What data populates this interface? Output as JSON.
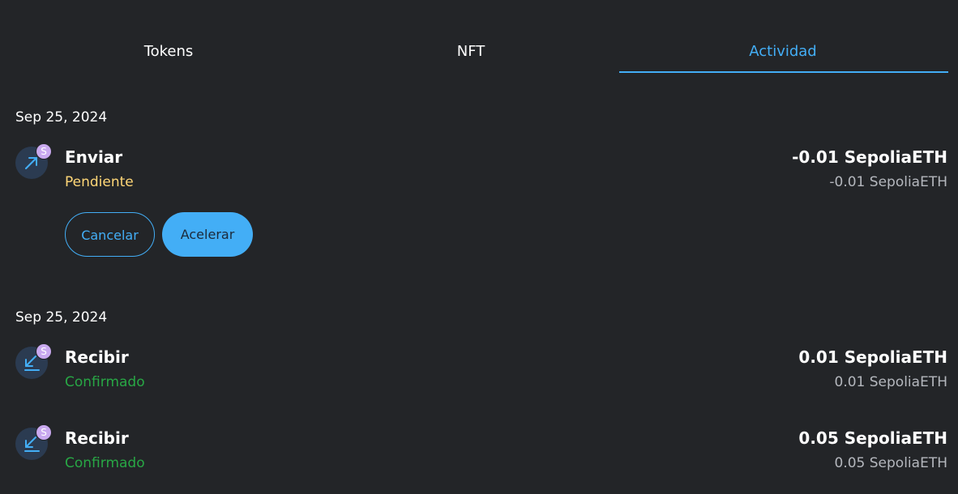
{
  "tabs": [
    {
      "label": "Tokens",
      "active": false
    },
    {
      "label": "NFT",
      "active": false
    },
    {
      "label": "Actividad",
      "active": true
    }
  ],
  "accent_color": "#43aef6",
  "groups": [
    {
      "date": "Sep 25, 2024",
      "transactions": [
        {
          "icon": "arrow-up-right-icon",
          "badge": "S",
          "title": "Enviar",
          "status": "Pendiente",
          "status_color": "#ffd777",
          "amount": "-0.01 SepoliaETH",
          "amount_secondary": "-0.01 SepoliaETH",
          "actions": {
            "cancel": "Cancelar",
            "speed_up": "Acelerar"
          }
        }
      ]
    },
    {
      "date": "Sep 25, 2024",
      "transactions": [
        {
          "icon": "arrow-down-left-icon",
          "badge": "S",
          "title": "Recibir",
          "status": "Confirmado",
          "status_color": "#28a745",
          "amount": "0.01 SepoliaETH",
          "amount_secondary": "0.01 SepoliaETH"
        },
        {
          "icon": "arrow-down-left-icon",
          "badge": "S",
          "title": "Recibir",
          "status": "Confirmado",
          "status_color": "#28a745",
          "amount": "0.05 SepoliaETH",
          "amount_secondary": "0.05 SepoliaETH"
        }
      ]
    }
  ]
}
